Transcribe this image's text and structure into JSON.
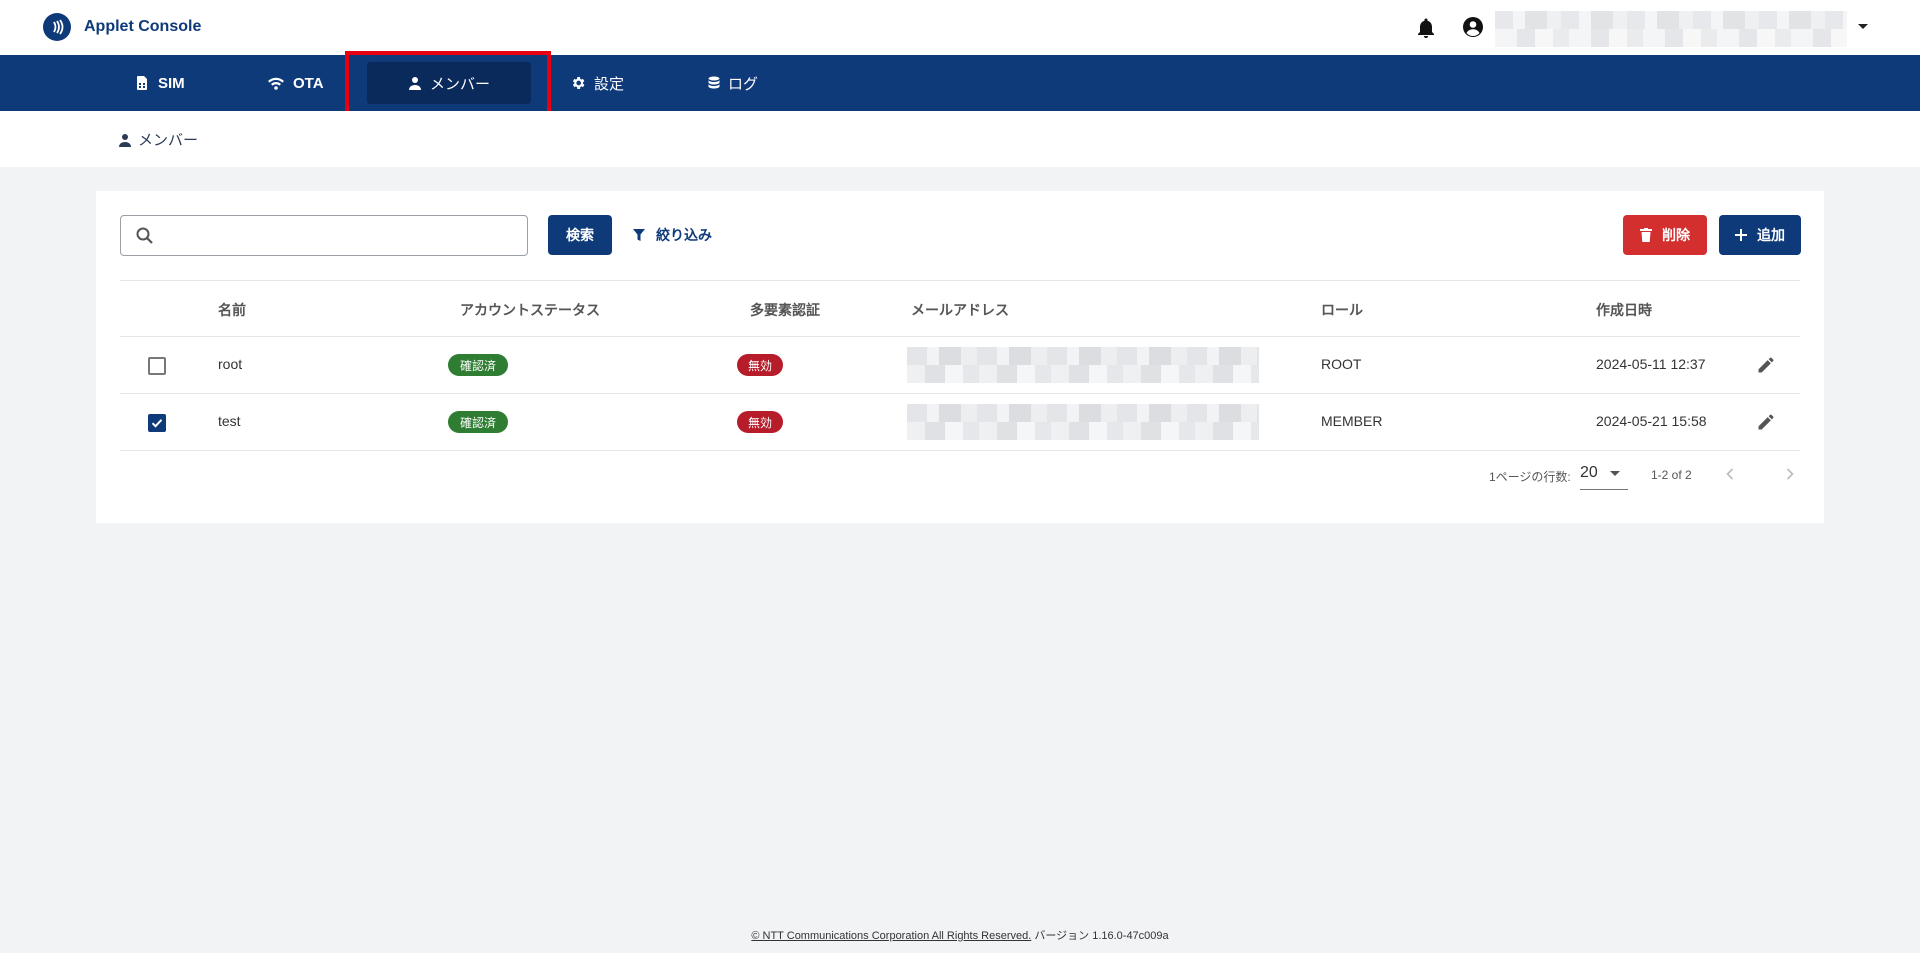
{
  "app": {
    "title": "Applet Console"
  },
  "nav": {
    "items": [
      {
        "label": "SIM",
        "icon": "sim-card-icon"
      },
      {
        "label": "OTA",
        "icon": "wifi-icon"
      },
      {
        "label": "メンバー",
        "icon": "person-icon",
        "active": true
      },
      {
        "label": "設定",
        "icon": "gear-icon"
      },
      {
        "label": "ログ",
        "icon": "database-icon"
      }
    ]
  },
  "breadcrumb": {
    "label": "メンバー"
  },
  "toolbar": {
    "search_placeholder": "",
    "search_label": "検索",
    "filter_label": "絞り込み",
    "delete_label": "削除",
    "add_label": "追加"
  },
  "table": {
    "columns": [
      "名前",
      "アカウントステータス",
      "多要素認証",
      "メールアドレス",
      "ロール",
      "作成日時"
    ],
    "rows": [
      {
        "checked": false,
        "name": "root",
        "status": "確認済",
        "mfa": "無効",
        "role": "ROOT",
        "created": "2024-05-11 12:37"
      },
      {
        "checked": true,
        "name": "test",
        "status": "確認済",
        "mfa": "無効",
        "role": "MEMBER",
        "created": "2024-05-21 15:58"
      }
    ]
  },
  "pagination": {
    "rows_per_page_label": "1ページの行数:",
    "rows_per_page": "20",
    "range": "1-2 of 2"
  },
  "footer": {
    "copyright": "© NTT Communications Corporation All Rights Reserved.",
    "version": "バージョン 1.16.0-47c009a"
  },
  "colors": {
    "primary": "#0f3a7a",
    "danger": "#d32f2f",
    "success_badge": "#2e7d32",
    "danger_badge": "#b71c2b",
    "highlight": "#e60012"
  }
}
